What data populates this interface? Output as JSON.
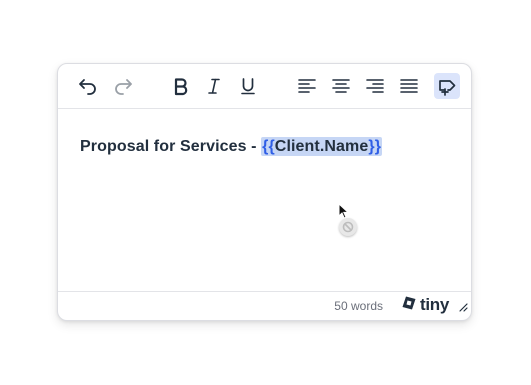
{
  "toolbar": {
    "buttons": [
      {
        "name": "undo",
        "icon": "undo-icon",
        "state": "enabled"
      },
      {
        "name": "redo",
        "icon": "redo-icon",
        "state": "disabled"
      },
      {
        "name": "bold",
        "icon": "bold-icon",
        "state": "enabled"
      },
      {
        "name": "italic",
        "icon": "italic-icon",
        "state": "enabled"
      },
      {
        "name": "underline",
        "icon": "underline-icon",
        "state": "enabled"
      },
      {
        "name": "align-left",
        "icon": "align-left-icon",
        "state": "enabled"
      },
      {
        "name": "align-center",
        "icon": "align-center-icon",
        "state": "enabled"
      },
      {
        "name": "align-right",
        "icon": "align-right-icon",
        "state": "enabled"
      },
      {
        "name": "justify",
        "icon": "align-justify-icon",
        "state": "enabled"
      },
      {
        "name": "insert-merge-tag",
        "icon": "merge-tag-icon",
        "state": "active"
      }
    ]
  },
  "content": {
    "text": "Proposal for Services - ",
    "merge_tag": {
      "open": "{{",
      "name": "Client.Name",
      "close": "}}"
    }
  },
  "statusbar": {
    "word_count": "50 words",
    "brand": "tiny"
  },
  "colors": {
    "text": "#222f3e",
    "merge_tag_bg": "#c6d6f5",
    "merge_brace": "#2f5ee6",
    "active_button_bg": "#dbe4fb"
  }
}
